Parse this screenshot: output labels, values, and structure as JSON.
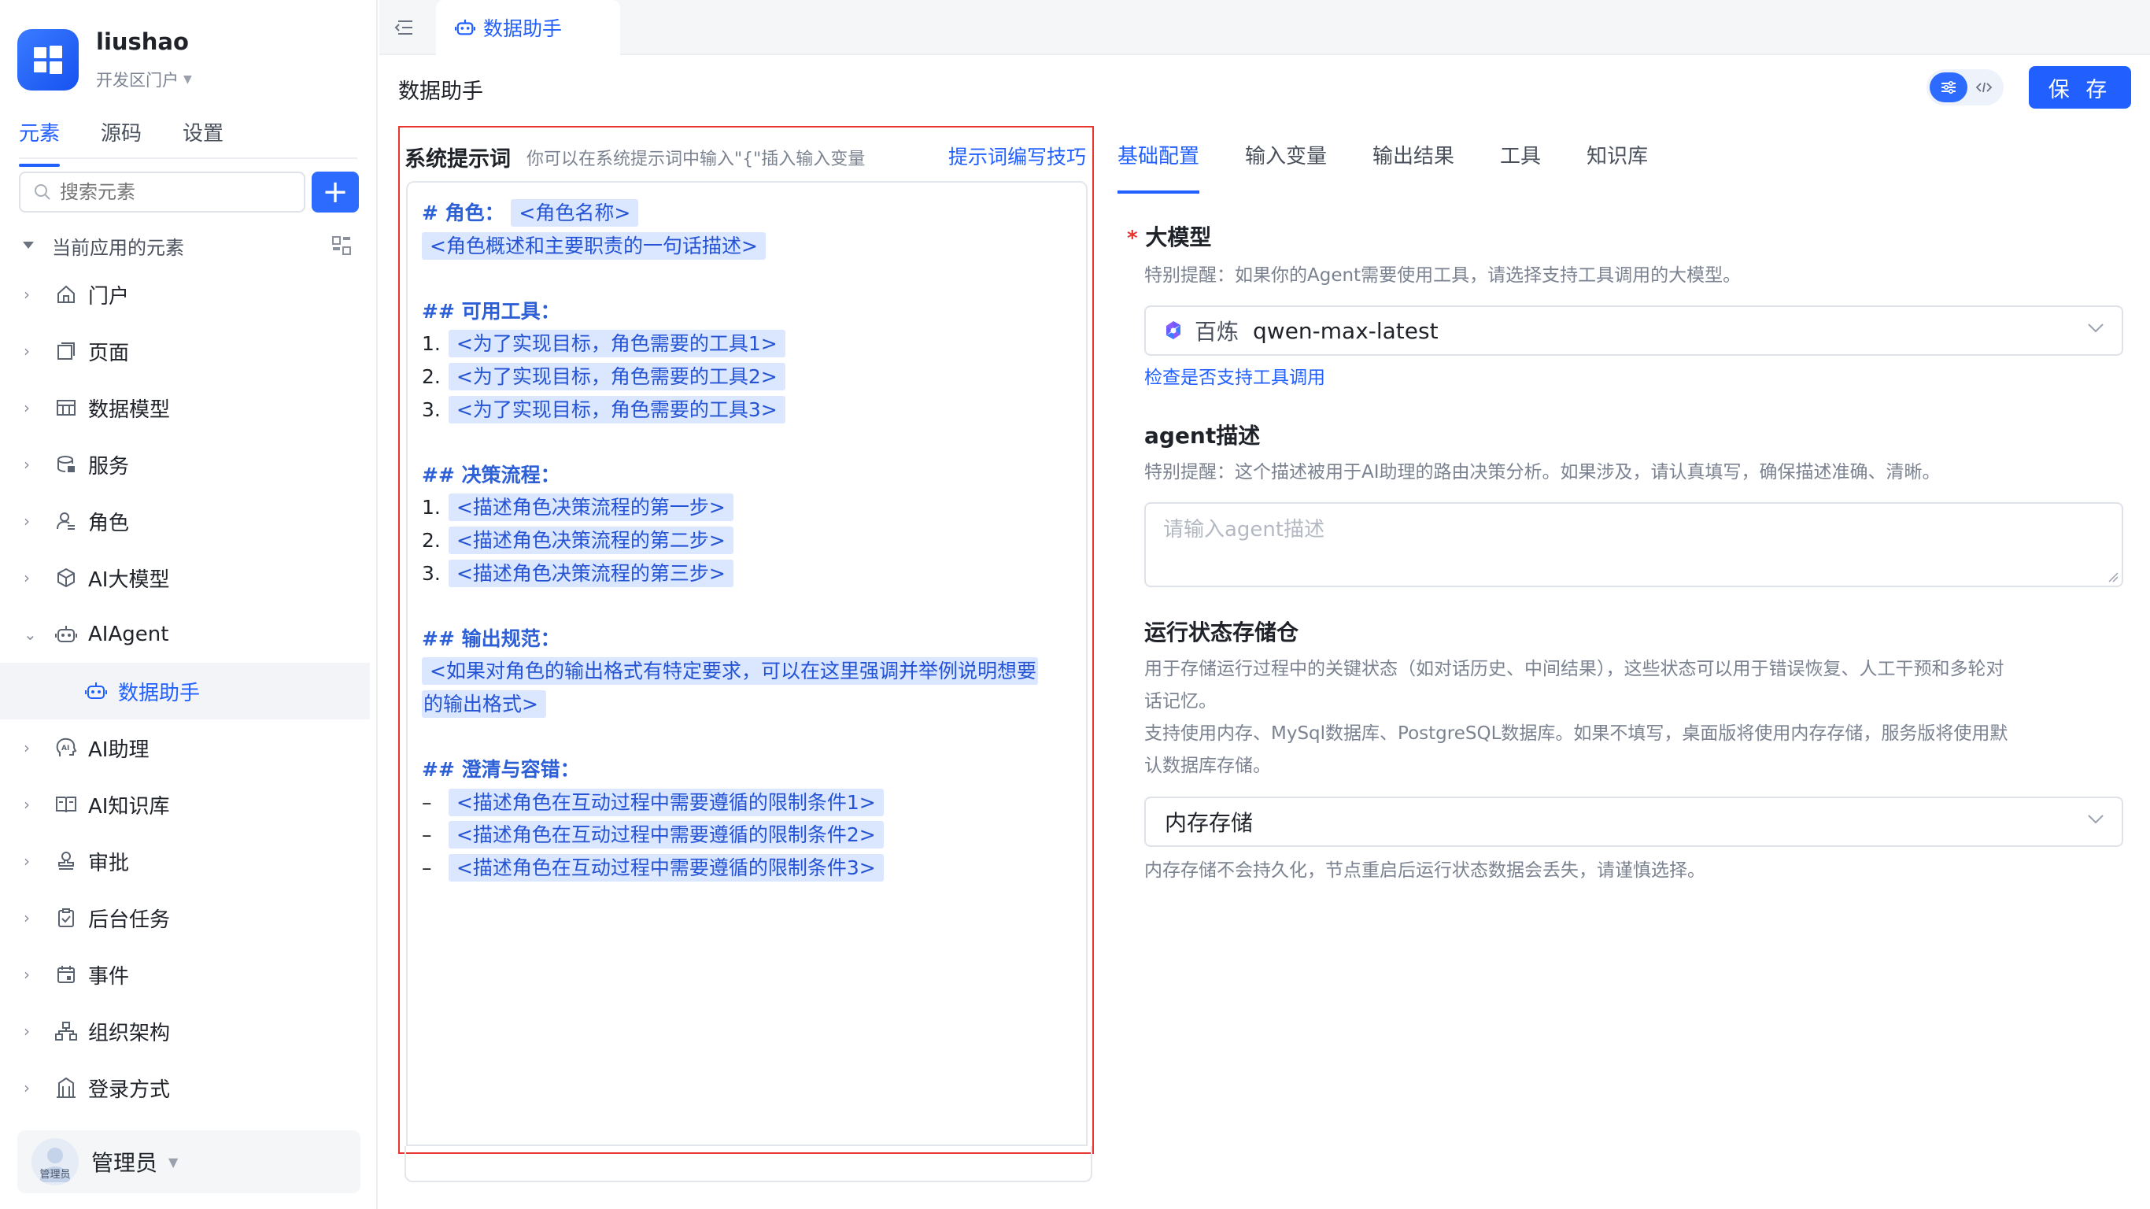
{
  "app": {
    "name": "liushao",
    "subtitle": "开发区门户"
  },
  "sidebar": {
    "tabs": [
      {
        "label": "元素"
      },
      {
        "label": "源码"
      },
      {
        "label": "设置"
      }
    ],
    "search": {
      "placeholder": "搜索元素"
    },
    "section": "当前应用的元素",
    "items": [
      {
        "label": "门户",
        "icon": "home-icon"
      },
      {
        "label": "页面",
        "icon": "page-icon"
      },
      {
        "label": "数据模型",
        "icon": "table-icon"
      },
      {
        "label": "服务",
        "icon": "service-icon"
      },
      {
        "label": "角色",
        "icon": "role-icon"
      },
      {
        "label": "AI大模型",
        "icon": "cube-icon"
      },
      {
        "label": "AIAgent",
        "icon": "robot-icon",
        "expanded": true
      },
      {
        "label": "数据助手",
        "icon": "robot-icon",
        "selected": true
      },
      {
        "label": "AI助理",
        "icon": "ai-head-icon"
      },
      {
        "label": "AI知识库",
        "icon": "book-icon"
      },
      {
        "label": "审批",
        "icon": "stamp-icon"
      },
      {
        "label": "后台任务",
        "icon": "task-icon"
      },
      {
        "label": "事件",
        "icon": "calendar-icon"
      },
      {
        "label": "组织架构",
        "icon": "org-icon"
      },
      {
        "label": "登录方式",
        "icon": "login-icon"
      }
    ],
    "user": {
      "avatar_label": "管理员",
      "name": "管理员"
    }
  },
  "topbar": {
    "tab_label": "数据助手"
  },
  "page": {
    "title": "数据助手",
    "save_label": "保 存"
  },
  "prompt": {
    "title": "系统提示词",
    "hint": "你可以在系统提示词中输入\"{\"插入输入变量",
    "tips_link": "提示词编写技巧",
    "role_heading": "# 角色：",
    "role_name": "<角色名称>",
    "role_desc": "<角色概述和主要职责的一句话描述>",
    "tools_heading": "## 可用工具：",
    "tools": [
      "<为了实现目标，角色需要的工具1>",
      "<为了实现目标，角色需要的工具2>",
      "<为了实现目标，角色需要的工具3>"
    ],
    "flow_heading": "## 决策流程：",
    "flow": [
      "<描述角色决策流程的第一步>",
      "<描述角色决策流程的第二步>",
      "<描述角色决策流程的第三步>"
    ],
    "output_heading": "## 输出规范：",
    "output_line1": "<如果对角色的输出格式有特定要求，可以在这里强调并举例说明想要",
    "output_line2": "的输出格式>",
    "clarify_heading": "## 澄清与容错：",
    "clarify": [
      "<描述角色在互动过程中需要遵循的限制条件1>",
      "<描述角色在互动过程中需要遵循的限制条件2>",
      "<描述角色在互动过程中需要遵循的限制条件3>"
    ]
  },
  "config": {
    "tabs": [
      {
        "label": "基础配置"
      },
      {
        "label": "输入变量"
      },
      {
        "label": "输出结果"
      },
      {
        "label": "工具"
      },
      {
        "label": "知识库"
      }
    ],
    "model": {
      "label": "大模型",
      "required_mark": "*",
      "note": "特别提醒：如果你的Agent需要使用工具，请选择支持工具调用的大模型。",
      "provider": "百炼",
      "value": "qwen-max-latest",
      "check_link": "检查是否支持工具调用"
    },
    "agent_desc": {
      "label": "agent描述",
      "note": "特别提醒：这个描述被用于AI助理的路由决策分析。如果涉及，请认真填写，确保描述准确、清晰。",
      "placeholder": "请输入agent描述"
    },
    "state_store": {
      "label": "运行状态存储仓",
      "note1": "用于存储运行过程中的关键状态（如对话历史、中间结果），这些状态可以用于错误恢复、人工干预和多轮对",
      "note2": "话记忆。",
      "note3": "支持使用内存、MySql数据库、PostgreSQL数据库。如果不填写，桌面版将使用内存存储，服务版将使用默",
      "note4": "认数据库存储。",
      "value": "内存存储",
      "warning": "内存存储不会持久化，节点重启后运行状态数据会丢失，请谨慎选择。"
    }
  },
  "colors": {
    "accent": "#2160ff",
    "highlight_border": "#e6362f",
    "tag_bg": "#dbe6ff"
  }
}
